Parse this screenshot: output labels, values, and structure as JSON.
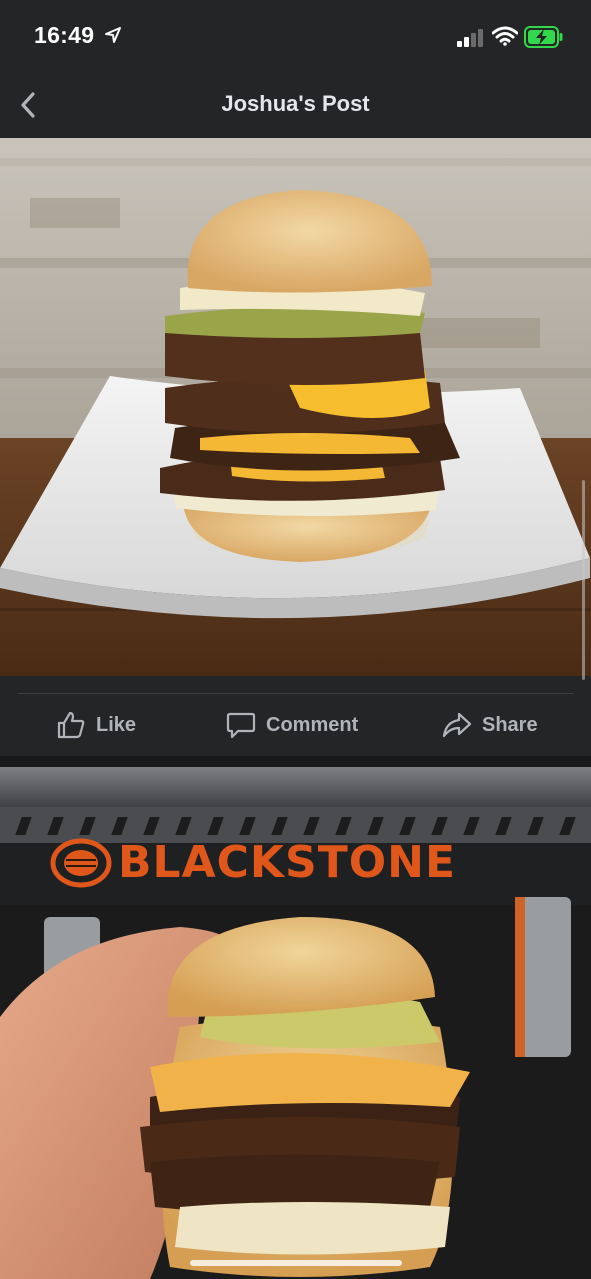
{
  "status_bar": {
    "time": "16:49",
    "icons": [
      "location-arrow-icon",
      "cellular-signal-icon",
      "wifi-icon",
      "battery-charging-icon"
    ],
    "battery_color": "#32d74b"
  },
  "nav": {
    "back_icon": "chevron-left-icon",
    "title": "Joshua's Post"
  },
  "photos": [
    {
      "name": "burger-on-white-plate-photo"
    },
    {
      "name": "burger-held-in-front-of-griddle-photo",
      "logo_text": "BLACKSTONE"
    }
  ],
  "actions": {
    "like": "Like",
    "comment": "Comment",
    "share": "Share"
  },
  "colors": {
    "background": "#242526",
    "text": "#e4e6eb",
    "action_text": "#b0b3b8",
    "brand_orange": "#e0571c"
  }
}
